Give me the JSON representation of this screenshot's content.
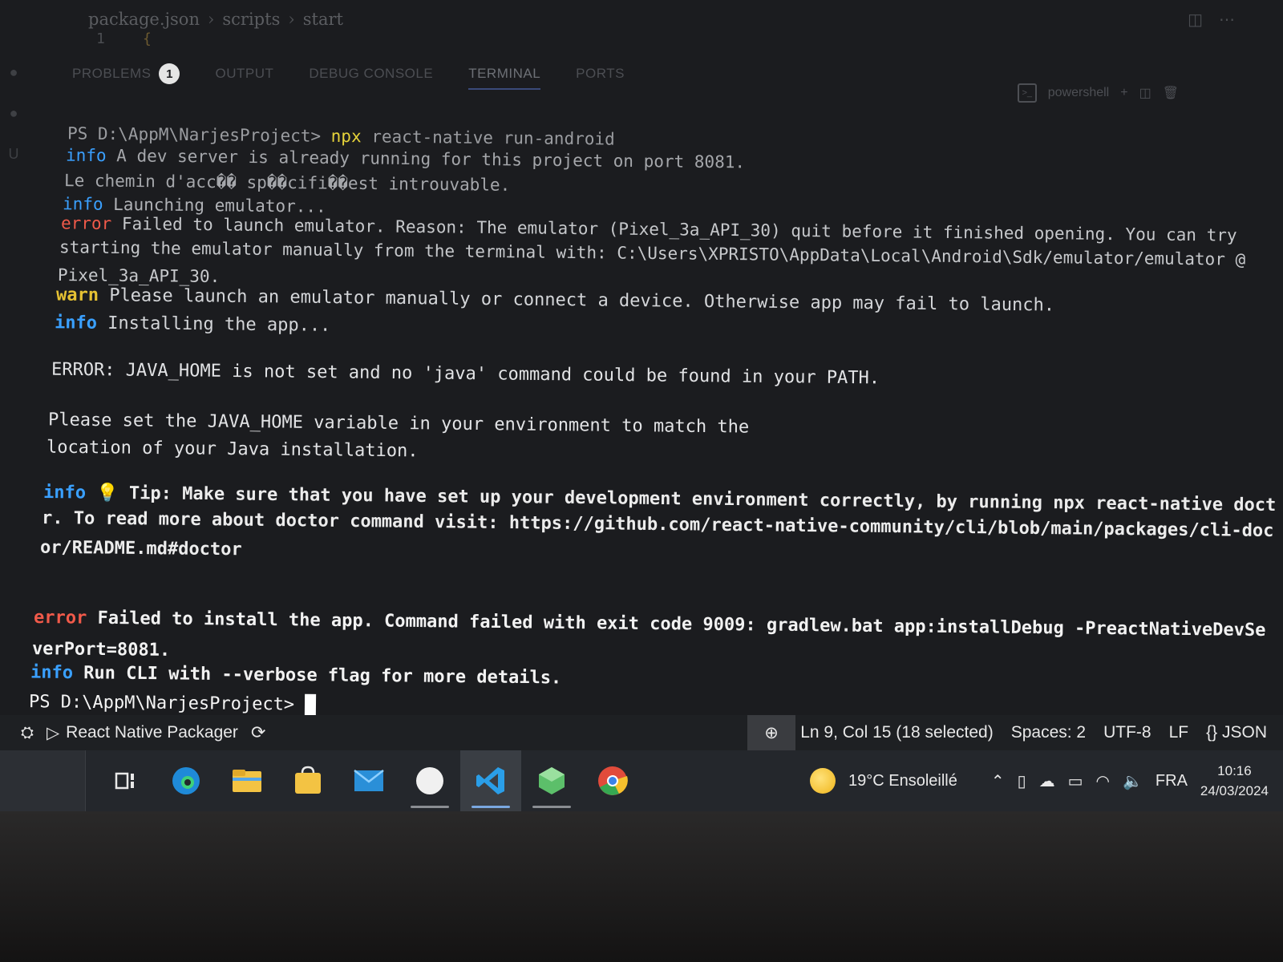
{
  "editor": {
    "breadcrumb": [
      "package.json",
      "scripts",
      "start"
    ],
    "line_number": "1",
    "line_brace": "{"
  },
  "panel": {
    "tabs": [
      {
        "label": "PROBLEMS",
        "badge": "1"
      },
      {
        "label": "OUTPUT"
      },
      {
        "label": "DEBUG CONSOLE"
      },
      {
        "label": "TERMINAL",
        "active": true
      },
      {
        "label": "PORTS"
      }
    ],
    "shell_name": "powershell",
    "add_label": "+"
  },
  "terminal": {
    "prompt1": "PS D:\\AppM\\NarjesProject>",
    "cmd_npx": "npx",
    "cmd_rest": " react-native run-android",
    "l2_kw": "info",
    "l2_text": " A dev server is already running for this project on port 8081.",
    "l3_text": "Le chemin d'acc�� sp��cifi��est introuvable.",
    "l4_kw": "info",
    "l4_text": " Launching emulator...",
    "l5_kw": "error",
    "l5_text": " Failed to launch emulator. Reason: The emulator (Pixel_3a_API_30) quit before it finished opening. You can try",
    "l6_text": "starting the emulator manually from the terminal with: C:\\Users\\XPRISTO\\AppData\\Local\\Android\\Sdk/emulator/emulator @",
    "l7_text": "Pixel_3a_API_30.",
    "l8_kw": "warn",
    "l8_text": " Please launch an emulator manually or connect a device. Otherwise app may fail to launch.",
    "l9_kw": "info",
    "l9_text": " Installing the app...",
    "l10_text": "ERROR: JAVA_HOME is not set and no 'java' command could be found in your PATH.",
    "l11_text": "Please set the JAVA_HOME variable in your environment to match the",
    "l12_text": "location of your Java installation.",
    "l13_kw": "info",
    "l13_bulb": "💡",
    "l13_text": " Tip: Make sure that you have set up your development environment correctly, by running ",
    "l13_bold": "npx react-native doct",
    "l14_bold": "r.",
    "l14_text": " To read more about doctor command visit: https://github.com/react-native-community/cli/blob/main/packages/cli-doc",
    "l15_text": "or/README.md#doctor",
    "l16_kw": "error",
    "l16_text": " Failed to install the app. Command failed with exit code 9009: gradlew.bat app:installDebug -PreactNativeDevSe",
    "l17_text": "verPort=8081.",
    "l18_kw": "info",
    "l18_text": " Run CLI with --verbose flag for more details.",
    "prompt2": "PS D:\\AppM\\NarjesProject>"
  },
  "statusbar": {
    "packager": "React Native Packager",
    "position": "Ln 9, Col 15 (18 selected)",
    "spaces": "Spaces: 2",
    "encoding": "UTF-8",
    "eol": "LF",
    "language": "{} JSON"
  },
  "taskbar": {
    "weather": "19°C  Ensoleillé",
    "lang": "FRA",
    "time": "10:16",
    "date": "24/03/2024",
    "apps": [
      "task-view",
      "edge",
      "file-explorer",
      "store",
      "mail",
      "app-white",
      "vscode",
      "app-green",
      "chrome"
    ]
  },
  "colors": {
    "info": "#3aa0ff",
    "error": "#f15a4a",
    "warn": "#e6c233",
    "npx": "#e6d33a",
    "terminal_bg": "#1b1c1f"
  }
}
